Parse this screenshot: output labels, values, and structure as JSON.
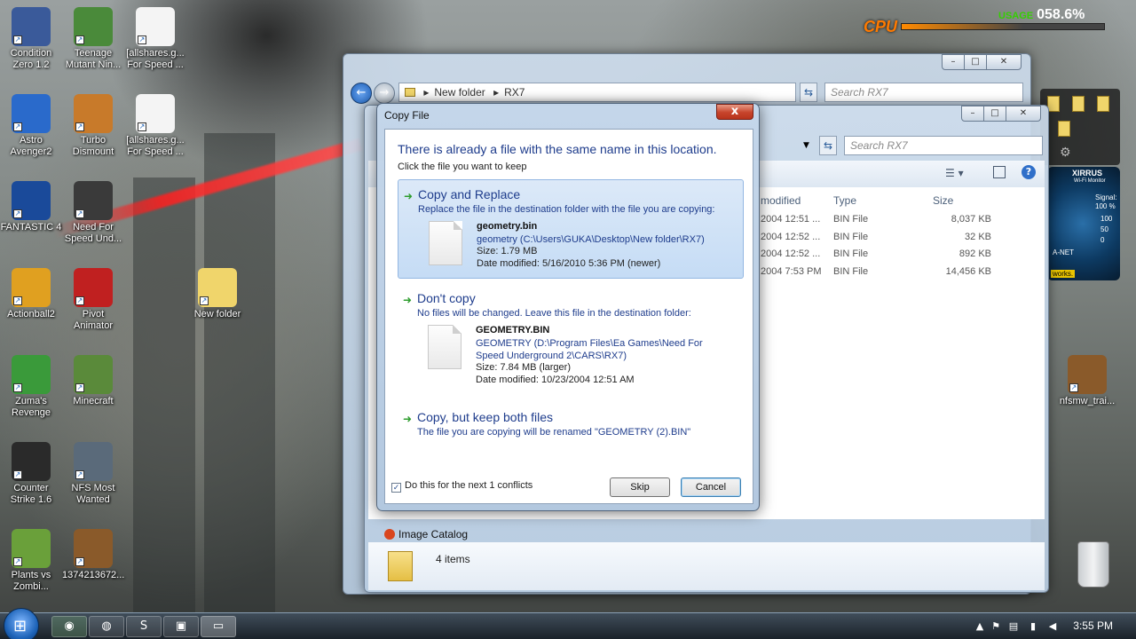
{
  "desktop": {
    "icons": [
      {
        "label": "Condition Zero 1.2",
        "color": "#3a5a9a"
      },
      {
        "label": "Teenage Mutant Nin...",
        "color": "#4a8a3a"
      },
      {
        "label": "[allshares.g... For Speed ...",
        "color": "#f4f4f4"
      },
      {
        "label": "Astro Avenger2",
        "color": "#2a6acb"
      },
      {
        "label": "Turbo Dismount",
        "color": "#c87a2a"
      },
      {
        "label": "[allshares.g... For Speed ...",
        "color": "#f4f4f4"
      },
      {
        "label": "FANTASTIC 4",
        "color": "#1a4a9a"
      },
      {
        "label": "Need For Speed Und...",
        "color": "#3a3a3a"
      },
      {
        "label": "Actionball2",
        "color": "#e0a020"
      },
      {
        "label": "Pivot Animator",
        "color": "#c02020"
      },
      {
        "label": "New folder",
        "color": "#f0d56b"
      },
      {
        "label": "Zuma's Revenge",
        "color": "#3a9a3a"
      },
      {
        "label": "Minecraft",
        "color": "#5a8a3a"
      },
      {
        "label": "Counter Strike 1.6",
        "color": "#2a2a2a"
      },
      {
        "label": "NFS Most Wanted",
        "color": "#5a6a7a"
      },
      {
        "label": "Plants vs Zombi...",
        "color": "#6aa03a"
      },
      {
        "label": "1374213672...",
        "color": "#8a5a2a"
      },
      {
        "label": "nfsmw_trai...",
        "color": "#8a5a2a"
      }
    ]
  },
  "cpu_widget": {
    "label": "CPU",
    "usage_label": "USAGE",
    "usage_value": "058.6%"
  },
  "xirrus_widget": {
    "brand": "XIRRUS",
    "subtitle": "Wi-Fi Monitor",
    "signal_label": "Signal:",
    "signal_value": "100 %",
    "scale": [
      "100",
      "50",
      "0"
    ],
    "network": "A-NET",
    "footer": "works."
  },
  "back_window": {
    "breadcrumb": [
      "New folder",
      "RX7"
    ],
    "search_placeholder": "Search RX7"
  },
  "front_window": {
    "search_placeholder": "Search RX7",
    "columns": [
      "modified",
      "Type",
      "Size"
    ],
    "rows": [
      {
        "date": "2004 12:51 ...",
        "type": "BIN File",
        "size": "8,037 KB"
      },
      {
        "date": "2004 12:52 ...",
        "type": "BIN File",
        "size": "32 KB"
      },
      {
        "date": "2004 12:52 ...",
        "type": "BIN File",
        "size": "892 KB"
      },
      {
        "date": "2004 7:53 PM",
        "type": "BIN File",
        "size": "14,456 KB"
      }
    ],
    "sidebar_item": "Image Catalog",
    "status": "4 items"
  },
  "dialog": {
    "title": "Copy File",
    "close_label": "x",
    "heading": "There is already a file with the same name in this location.",
    "subheading": "Click the file you want to keep",
    "options": {
      "replace": {
        "title": "Copy and Replace",
        "description": "Replace the file in the destination folder with the file you are copying:",
        "file_name": "geometry.bin",
        "file_path": "geometry (C:\\Users\\GUKA\\Desktop\\New folder\\RX7)",
        "size": "Size: 1.79 MB",
        "modified": "Date modified: 5/16/2010 5:36 PM (newer)"
      },
      "dont_copy": {
        "title": "Don't copy",
        "description": "No files will be changed. Leave this file in the destination folder:",
        "file_name": "GEOMETRY.BIN",
        "file_path": "GEOMETRY (D:\\Program Files\\Ea Games\\Need For Speed Underground 2\\CARS\\RX7)",
        "size": "Size: 7.84 MB (larger)",
        "modified": "Date modified: 10/23/2004 12:51 AM"
      },
      "keep_both": {
        "title": "Copy, but keep both files",
        "description": "The file you are copying will be renamed \"GEOMETRY (2).BIN\""
      }
    },
    "checkbox_label": "Do this for the next 1 conflicts",
    "checkbox_checked": true,
    "skip_label": "Skip",
    "cancel_label": "Cancel"
  },
  "taskbar": {
    "apps": [
      "chrome-icon",
      "firefox-icon",
      "skype-icon",
      "app-icon",
      "explorer-icon"
    ],
    "clock": "3:55 PM"
  }
}
